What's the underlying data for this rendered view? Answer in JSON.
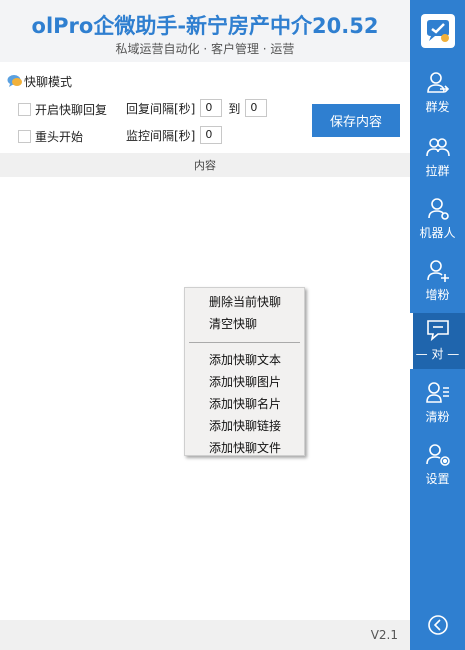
{
  "header": {
    "title": "olPro企微助手-新宁房产中介20.52",
    "subtitle": "私域运营自动化 · 客户管理 · 运营"
  },
  "mode": {
    "title": "快聊模式",
    "auto_reply_label": "开启快聊回复",
    "reply_interval_label": "回复间隔[秒]",
    "reply_from": "0",
    "to_label": "到",
    "reply_to": "0",
    "restart_label": "重头开始",
    "monitor_interval_label": "监控间隔[秒]",
    "monitor_value": "0",
    "save_label": "保存内容"
  },
  "content": {
    "header": "内容"
  },
  "context_menu": {
    "items": [
      "删除当前快聊",
      "清空快聊",
      "添加快聊文本",
      "添加快聊图片",
      "添加快聊名片",
      "添加快聊链接",
      "添加快聊文件"
    ]
  },
  "footer": {
    "version": "V2.1"
  },
  "sidebar": {
    "items": [
      {
        "label": "群发",
        "icon": "person-send-icon"
      },
      {
        "label": "拉群",
        "icon": "group-icon"
      },
      {
        "label": "机器人",
        "icon": "robot-icon"
      },
      {
        "label": "增粉",
        "icon": "add-user-icon"
      },
      {
        "label": "— 对 —",
        "icon": "chat-icon"
      },
      {
        "label": "清粉",
        "icon": "clear-user-icon"
      },
      {
        "label": "设置",
        "icon": "settings-user-icon"
      }
    ],
    "accent_color": "#2f7fd0",
    "active_color": "#1f65ad"
  }
}
